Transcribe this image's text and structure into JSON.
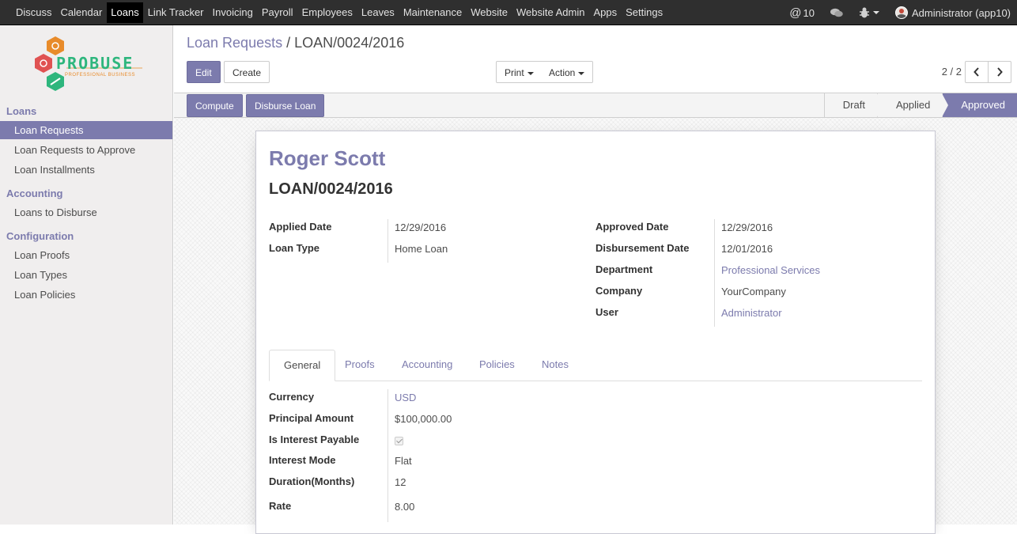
{
  "topmenu": {
    "items": [
      "Discuss",
      "Calendar",
      "Loans",
      "Link Tracker",
      "Invoicing",
      "Payroll",
      "Employees",
      "Leaves",
      "Maintenance",
      "Website",
      "Website Admin",
      "Apps",
      "Settings"
    ],
    "active": "Loans",
    "mentions_count": "10",
    "user_label": "Administrator (app10)"
  },
  "logo": {
    "brand": "PROBUSE",
    "tagline": "PROFESSIONAL BUSINESS"
  },
  "sidebar": {
    "sections": [
      {
        "title": "Loans",
        "items": [
          "Loan Requests",
          "Loan Requests to Approve",
          "Loan Installments"
        ]
      },
      {
        "title": "Accounting",
        "items": [
          "Loans to Disburse"
        ]
      },
      {
        "title": "Configuration",
        "items": [
          "Loan Proofs",
          "Loan Types",
          "Loan Policies"
        ]
      }
    ],
    "active_item": "Loan Requests"
  },
  "breadcrumb": {
    "parent": "Loan Requests",
    "separator": "/",
    "current": "LOAN/0024/2016"
  },
  "buttons": {
    "edit": "Edit",
    "create": "Create",
    "print": "Print",
    "action": "Action",
    "compute": "Compute",
    "disburse": "Disburse Loan"
  },
  "pager": {
    "label": "2 / 2"
  },
  "statusbar": {
    "stages": [
      "Draft",
      "Applied",
      "Approved"
    ],
    "current": "Approved"
  },
  "form": {
    "employee_name": "Roger Scott",
    "reference": "LOAN/0024/2016",
    "left_fields": [
      {
        "label": "Applied Date",
        "value": "12/29/2016"
      },
      {
        "label": "Loan Type",
        "value": "Home Loan"
      }
    ],
    "right_fields": [
      {
        "label": "Approved Date",
        "value": "12/29/2016"
      },
      {
        "label": "Disbursement Date",
        "value": "12/01/2016"
      },
      {
        "label": "Department",
        "value": "Professional Services"
      },
      {
        "label": "Company",
        "value": "YourCompany"
      },
      {
        "label": "User",
        "value": "Administrator"
      }
    ],
    "tabs": [
      "General",
      "Proofs",
      "Accounting",
      "Policies",
      "Notes"
    ],
    "active_tab": "General",
    "general": [
      {
        "label": "Currency",
        "value": "USD"
      },
      {
        "label": "Principal Amount",
        "value": "$100,000.00"
      },
      {
        "label": "Is Interest Payable",
        "value": true
      },
      {
        "label": "Interest Mode",
        "value": "Flat"
      },
      {
        "label": "Duration(Months)",
        "value": "12"
      },
      {
        "label": "Rate",
        "value": "8.00"
      }
    ]
  },
  "colors": {
    "accent": "#7c7bad",
    "topbar": "#2f2f2f",
    "logo_green": "#2eb67d",
    "logo_orange": "#e88b2a",
    "logo_red": "#e05252"
  }
}
